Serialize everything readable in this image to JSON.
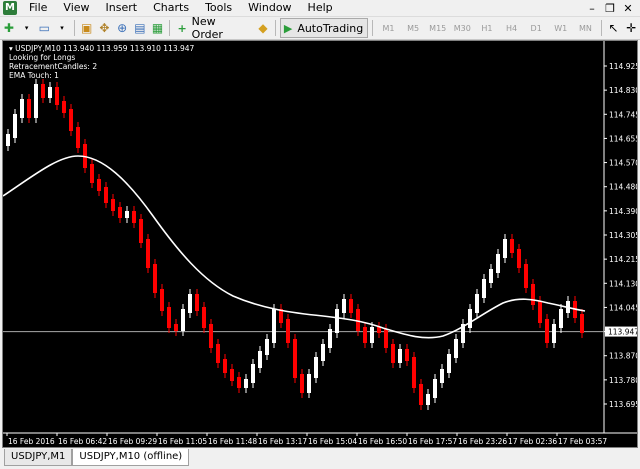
{
  "menu": {
    "items": [
      "File",
      "View",
      "Insert",
      "Charts",
      "Tools",
      "Window",
      "Help"
    ]
  },
  "toolbar": {
    "new_order": "New Order",
    "autotrading": "AutoTrading",
    "timeframes": [
      "M1",
      "M5",
      "M15",
      "M30",
      "H1",
      "H4",
      "D1",
      "W1",
      "MN"
    ]
  },
  "chart": {
    "symbol_line": "USDJPY,M10  113.940 113.959 113.910 113.947",
    "info_lines": [
      "Looking for Longs",
      "RetracementCandles: 2",
      "EMA Touch: 1"
    ],
    "current_price": "113.947",
    "price_ticks": [
      "114.925",
      "114.830",
      "114.745",
      "114.655",
      "114.570",
      "114.480",
      "114.390",
      "114.305",
      "114.215",
      "114.130",
      "114.045",
      "113.947",
      "113.870",
      "113.780",
      "113.695"
    ],
    "time_ticks": [
      "16 Feb 2016",
      "16 Feb 06:42",
      "16 Feb 09:29",
      "16 Feb 11:05",
      "16 Feb 11:48",
      "16 Feb 13:17",
      "16 Feb 15:04",
      "16 Feb 16:50",
      "16 Feb 17:57",
      "16 Feb 23:26",
      "17 Feb 02:36",
      "17 Feb 03:57"
    ],
    "colors": {
      "background": "#000000",
      "bull": "#ffffff",
      "bear": "#ff0000",
      "ema": "#ffffff"
    }
  },
  "tabs": [
    "USDJPY,M1",
    "USDJPY,M10 (offline)"
  ]
}
